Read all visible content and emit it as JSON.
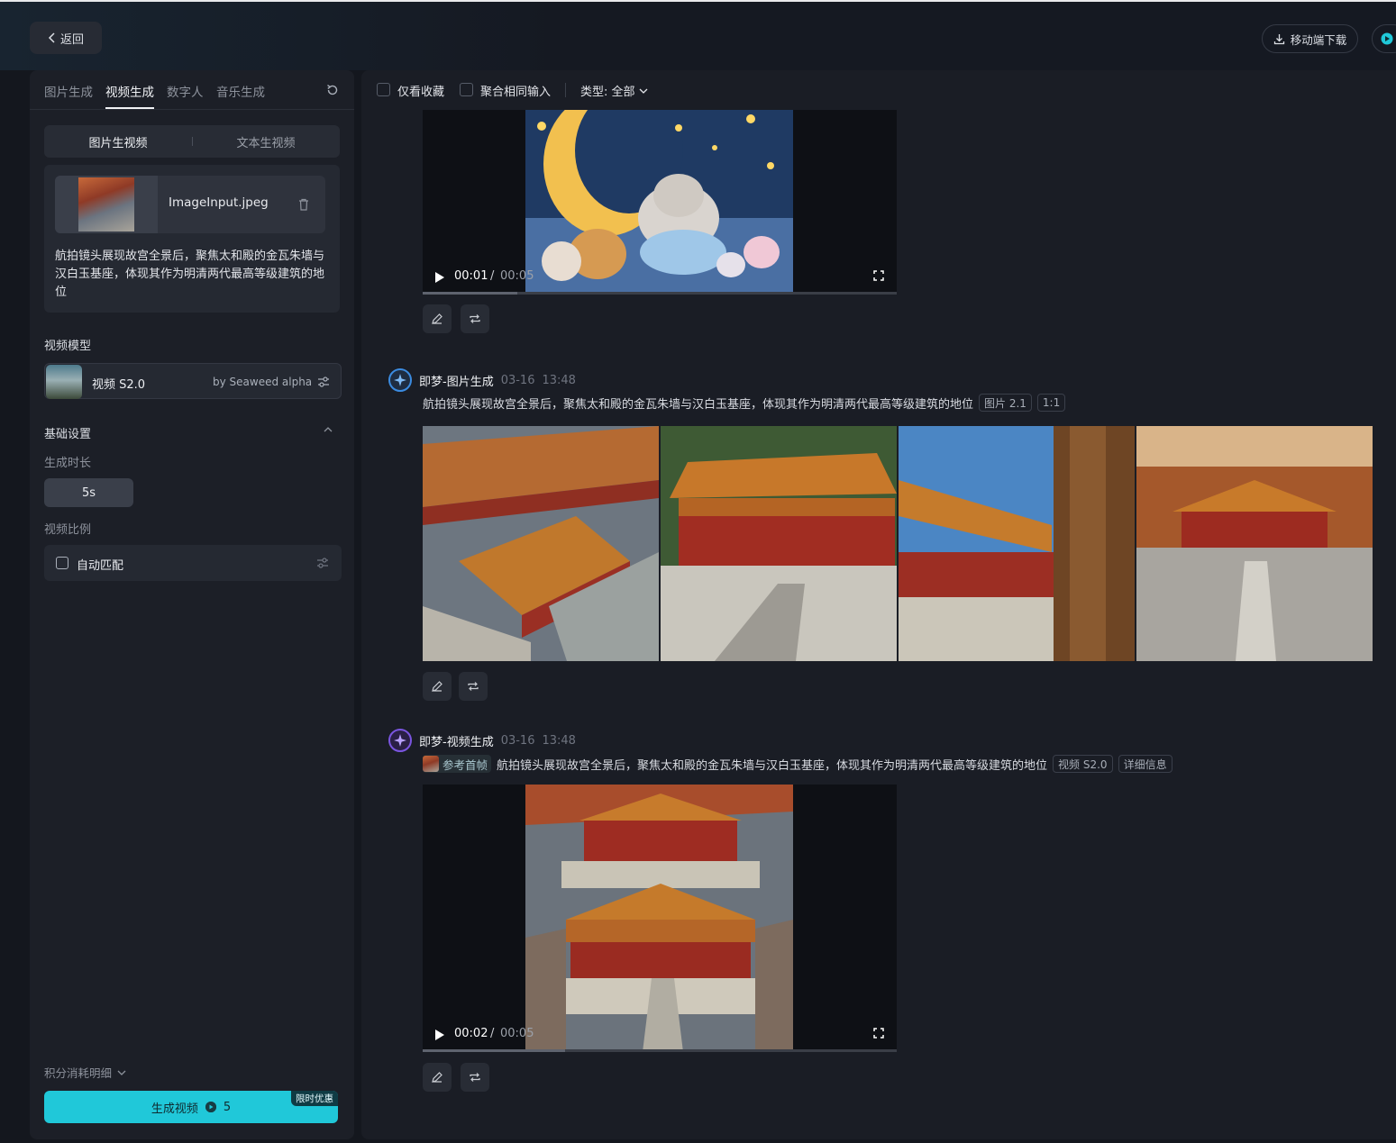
{
  "topbar": {
    "back_label": "返回",
    "mobile_download_label": "移动端下载"
  },
  "left": {
    "tabs": [
      {
        "label": "图片生成",
        "active": false
      },
      {
        "label": "视频生成",
        "active": true
      },
      {
        "label": "数字人",
        "active": false
      },
      {
        "label": "音乐生成",
        "active": false
      }
    ],
    "mode": {
      "image_to_video": "图片生视频",
      "text_to_video": "文本生视频",
      "active": "图片生视频"
    },
    "file_name": "ImageInput.jpeg",
    "prompt": "航拍镜头展现故宫全景后，聚焦太和殿的金瓦朱墙与汉白玉基座，体现其作为明清两代最高等级建筑的地位",
    "model_section_label": "视频模型",
    "model_name": "视频 S2.0",
    "model_by": "by Seaweed alpha",
    "basic_settings_label": "基础设置",
    "duration_label": "生成时长",
    "duration_value": "5s",
    "ratio_label": "视频比例",
    "ratio_value": "自动匹配",
    "credits_detail_label": "积分消耗明细",
    "generate_label": "生成视频",
    "generate_cost": "5",
    "promo_badge": "限时优惠"
  },
  "filters": {
    "favorites_only": "仅看收藏",
    "merge_same_input": "聚合相同输入",
    "type_filter": "类型: 全部"
  },
  "feed": {
    "video1": {
      "current": "00:01",
      "separator": "/",
      "duration": "00:05",
      "progress": 0.2
    },
    "image_gen": {
      "title": "即梦-图片生成",
      "date": "03-16",
      "time": "13:48",
      "prompt": "航拍镜头展现故宫全景后，聚焦太和殿的金瓦朱墙与汉白玉基座，体现其作为明清两代最高等级建筑的地位",
      "tags": [
        "图片 2.1",
        "1:1"
      ]
    },
    "video_gen": {
      "title": "即梦-视频生成",
      "date": "03-16",
      "time": "13:48",
      "ref_label": "参考首帧",
      "prompt": "航拍镜头展现故宫全景后，聚焦太和殿的金瓦朱墙与汉白玉基座，体现其作为明清两代最高等级建筑的地位",
      "tags": [
        "视频 S2.0",
        "详细信息"
      ]
    },
    "video2": {
      "current": "00:02",
      "separator": "/",
      "duration": "00:05",
      "progress": 0.3
    }
  },
  "colors": {
    "accent": "#20c8d9",
    "background": "#14171e",
    "panel": "#1c1f27"
  }
}
